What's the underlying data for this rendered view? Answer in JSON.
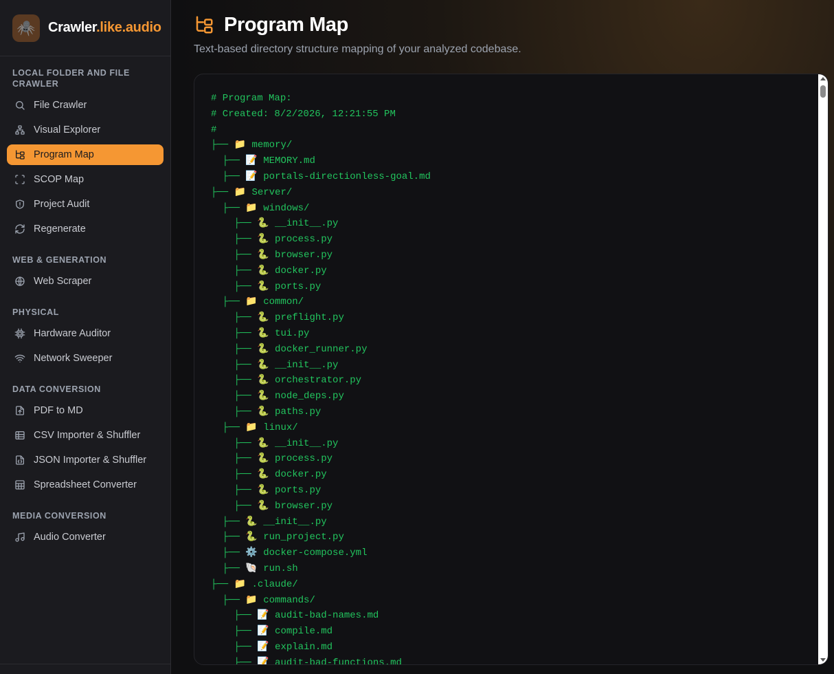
{
  "brand": {
    "logo_icon": "spider-icon",
    "name_part1": "Crawler",
    "name_part2": ".like.audio",
    "accent": "#f59733"
  },
  "sidebar": {
    "sections": [
      {
        "title": "LOCAL FOLDER AND FILE CRAWLER",
        "items": [
          {
            "label": "File Crawler",
            "icon": "search-icon"
          },
          {
            "label": "Visual Explorer",
            "icon": "network-icon"
          },
          {
            "label": "Program Map",
            "icon": "folder-tree-icon",
            "active": true
          },
          {
            "label": "SCOP Map",
            "icon": "scan-icon"
          },
          {
            "label": "Project Audit",
            "icon": "shield-alert-icon"
          },
          {
            "label": "Regenerate",
            "icon": "refresh-icon"
          }
        ]
      },
      {
        "title": "WEB & GENERATION",
        "items": [
          {
            "label": "Web Scraper",
            "icon": "globe-icon"
          }
        ]
      },
      {
        "title": "PHYSICAL",
        "items": [
          {
            "label": "Hardware Auditor",
            "icon": "cpu-icon"
          },
          {
            "label": "Network Sweeper",
            "icon": "wifi-icon"
          }
        ]
      },
      {
        "title": "DATA CONVERSION",
        "items": [
          {
            "label": "PDF to MD",
            "icon": "file-up-icon"
          },
          {
            "label": "CSV Importer & Shuffler",
            "icon": "table-icon"
          },
          {
            "label": "JSON Importer & Shuffler",
            "icon": "file-json-icon"
          },
          {
            "label": "Spreadsheet Converter",
            "icon": "sheet-icon"
          }
        ]
      },
      {
        "title": "MEDIA CONVERSION",
        "items": [
          {
            "label": "Audio Converter",
            "icon": "music-icon"
          }
        ]
      }
    ]
  },
  "header": {
    "title_icon": "folder-tree-icon",
    "title": "Program Map",
    "subtitle": "Text-based directory structure mapping of your analyzed codebase."
  },
  "program_map": {
    "lines": [
      "# Program Map:",
      "# Created: 8/2/2026, 12:21:55 PM",
      "#",
      "├── 📁 memory/",
      "  ├── 📝 MEMORY.md",
      "  ├── 📝 portals-directionless-goal.md",
      "├── 📁 Server/",
      "  ├── 📁 windows/",
      "    ├── 🐍 __init__.py",
      "    ├── 🐍 process.py",
      "    ├── 🐍 browser.py",
      "    ├── 🐍 docker.py",
      "    ├── 🐍 ports.py",
      "  ├── 📁 common/",
      "    ├── 🐍 preflight.py",
      "    ├── 🐍 tui.py",
      "    ├── 🐍 docker_runner.py",
      "    ├── 🐍 __init__.py",
      "    ├── 🐍 orchestrator.py",
      "    ├── 🐍 node_deps.py",
      "    ├── 🐍 paths.py",
      "  ├── 📁 linux/",
      "    ├── 🐍 __init__.py",
      "    ├── 🐍 process.py",
      "    ├── 🐍 docker.py",
      "    ├── 🐍 ports.py",
      "    ├── 🐍 browser.py",
      "  ├── 🐍 __init__.py",
      "  ├── 🐍 run_project.py",
      "  ├── ⚙️ docker-compose.yml",
      "  ├── 🐚 run.sh",
      "├── 📁 .claude/",
      "  ├── 📁 commands/",
      "    ├── 📝 audit-bad-names.md",
      "    ├── 📝 compile.md",
      "    ├── 📝 explain.md",
      "    ├── 📝 audit-bad-functions.md"
    ]
  }
}
